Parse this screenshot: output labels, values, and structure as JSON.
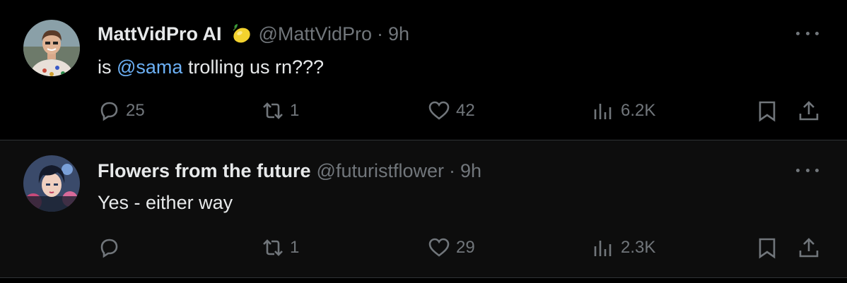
{
  "tweets": [
    {
      "name": "MattVidPro AI",
      "handle": "@MattVidPro",
      "separator": "·",
      "time": "9h",
      "text_prefix": "is ",
      "mention": "@sama",
      "text_suffix": " trolling us rn???",
      "replies": "25",
      "reposts": "1",
      "likes": "42",
      "views": "6.2K",
      "badge_icon": "lemon-icon"
    },
    {
      "name": "Flowers from the future",
      "handle": "@futuristflower",
      "separator": "·",
      "time": "9h",
      "text": "Yes - either way",
      "replies": "",
      "reposts": "1",
      "likes": "29",
      "views": "2.3K"
    }
  ],
  "colors": {
    "background": "#000000",
    "reply_background": "#0d0d0d",
    "primary_text": "#e7e9ea",
    "secondary_text": "#71767b",
    "mention": "#6cb0f5"
  }
}
